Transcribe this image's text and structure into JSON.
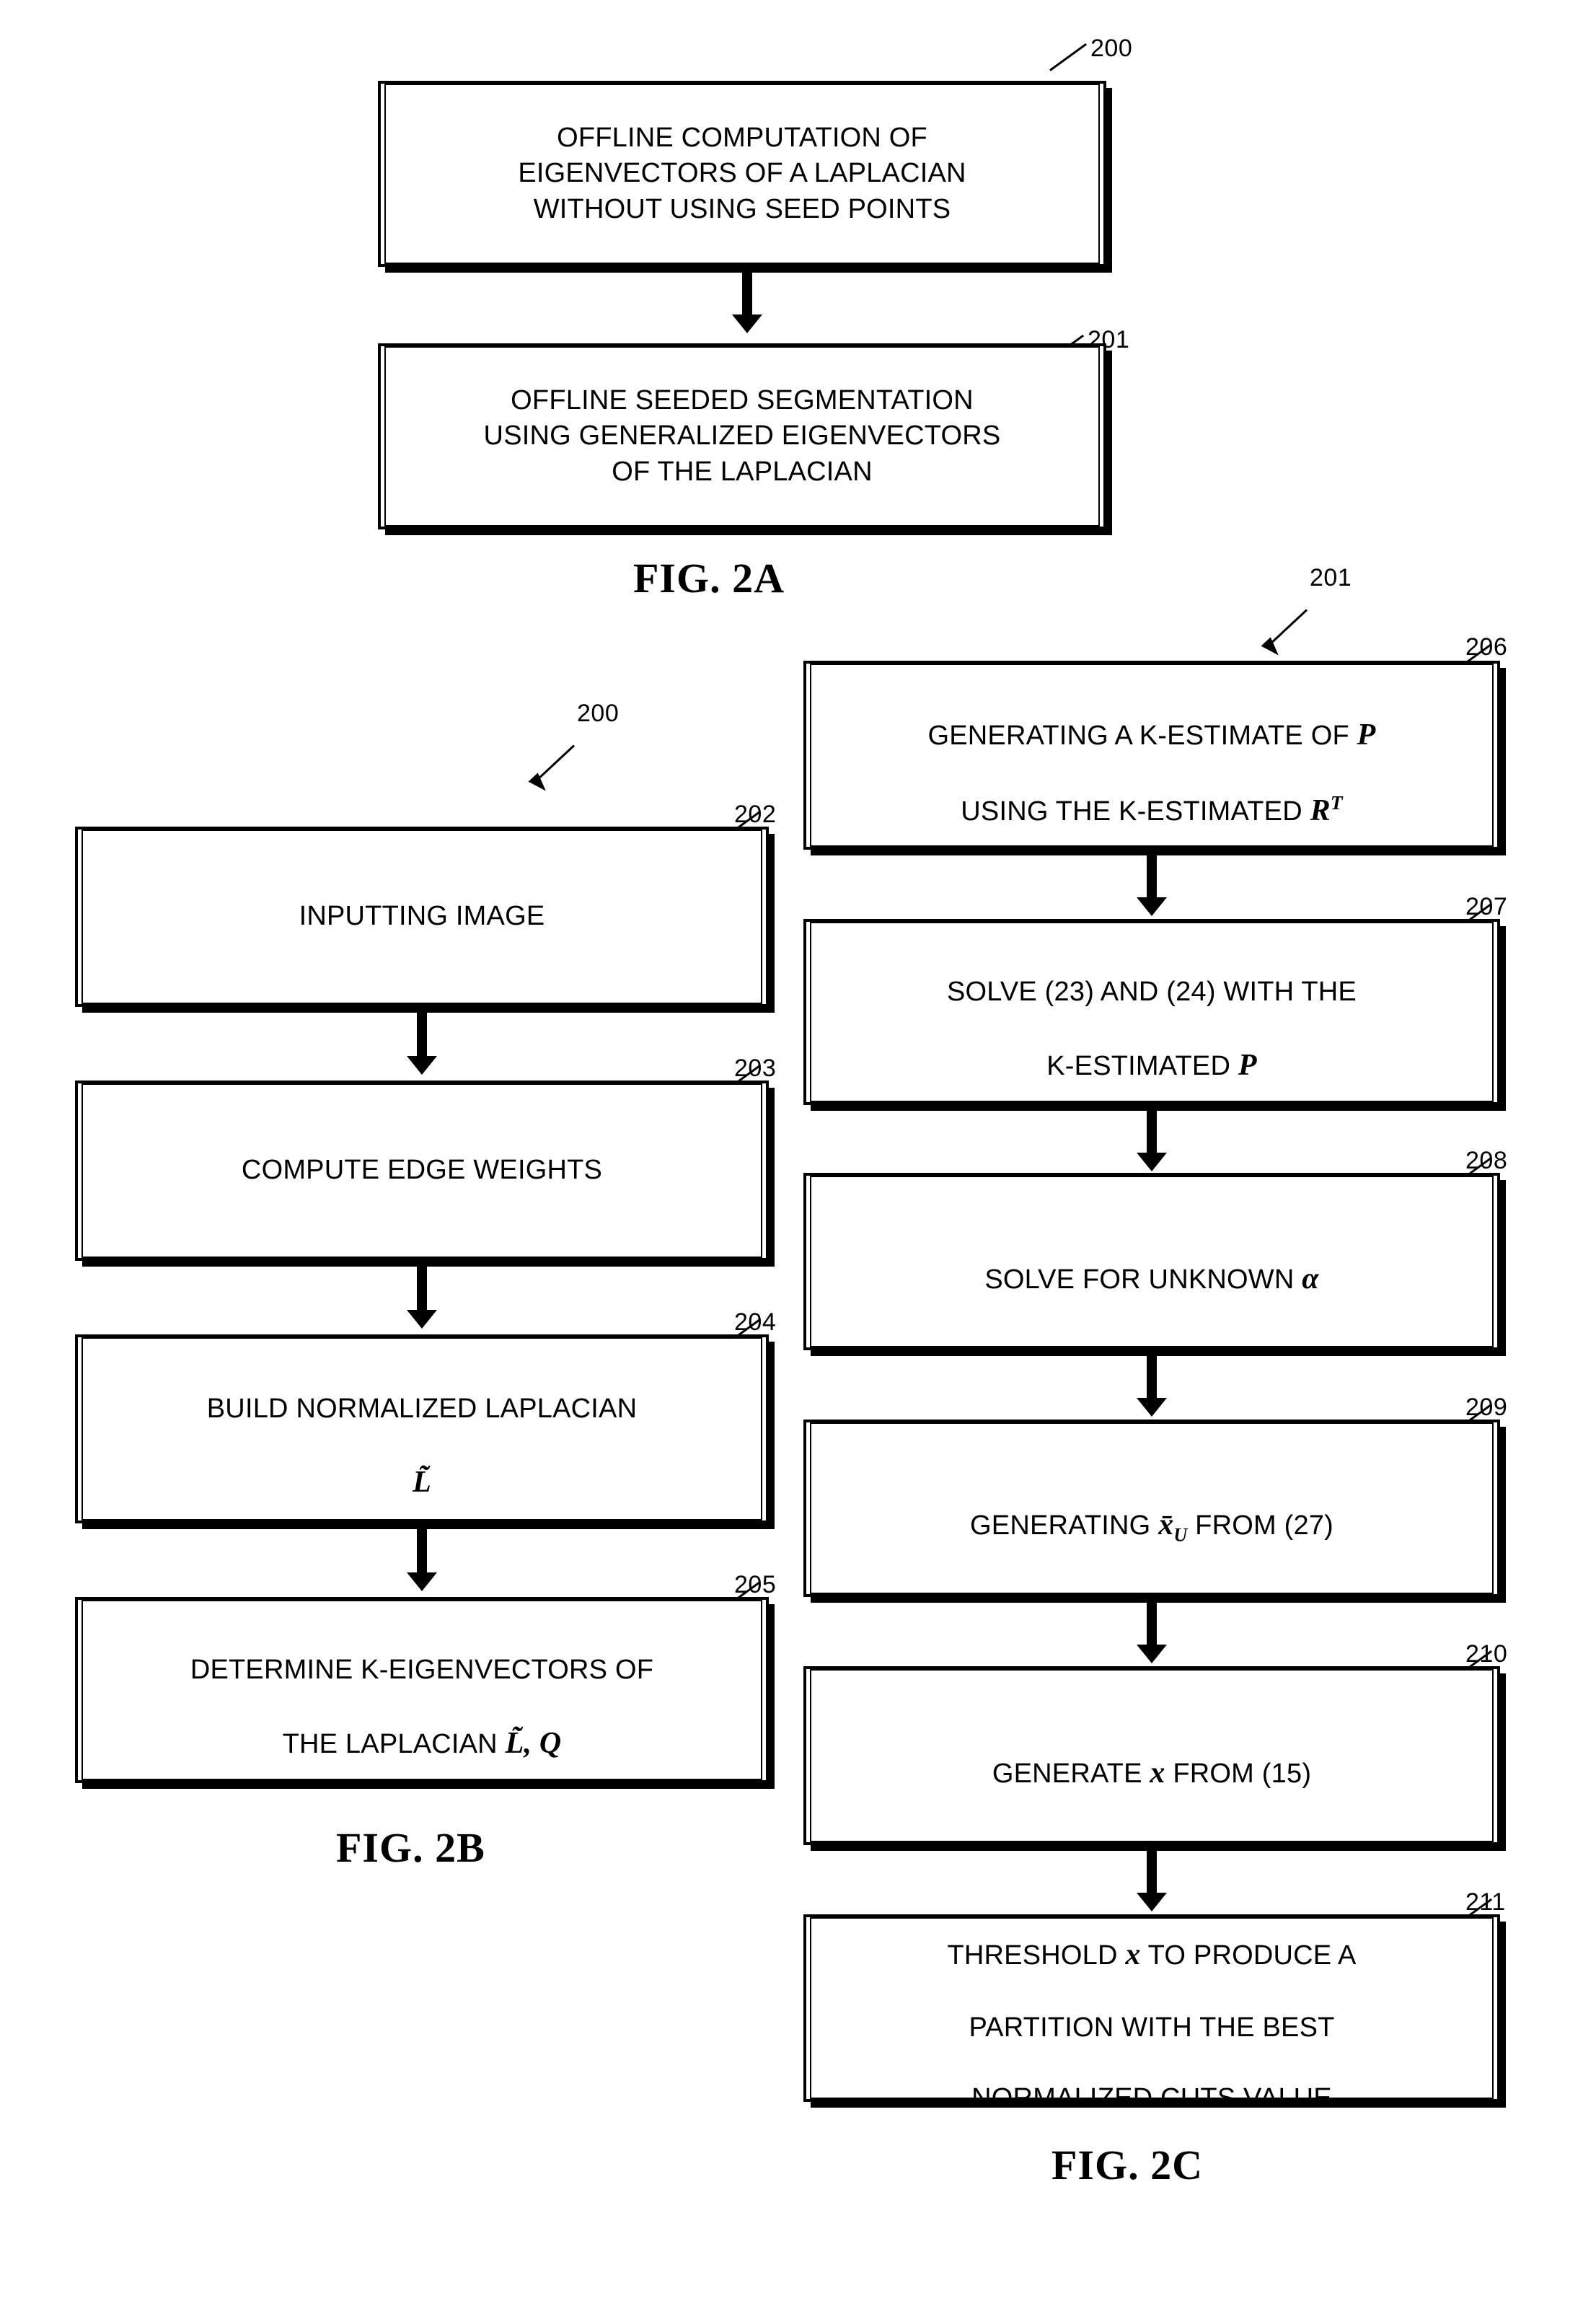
{
  "figure": {
    "title": "Flowchart figures 2A, 2B, 2C",
    "captions": {
      "fig2a": "FIG. 2A",
      "fig2b": "FIG. 2B",
      "fig2c": "FIG. 2C"
    }
  },
  "fig2a": {
    "ref_top": "200",
    "ref_bottom": "201",
    "boxes": [
      {
        "ref": "200",
        "text": "OFFLINE COMPUTATION OF\nEIGENVECTORS OF A LAPLACIAN\nWITHOUT USING SEED POINTS"
      },
      {
        "ref": "201",
        "text": "OFFLINE SEEDED SEGMENTATION\nUSING GENERALIZED EIGENVECTORS\nOF THE LAPLACIAN"
      }
    ]
  },
  "fig2b": {
    "pointer_ref": "200",
    "boxes": [
      {
        "ref": "202",
        "text": "INPUTTING IMAGE"
      },
      {
        "ref": "203",
        "text": "COMPUTE EDGE WEIGHTS"
      },
      {
        "ref": "204",
        "line1": "BUILD NORMALIZED LAPLACIAN",
        "math": "L̃"
      },
      {
        "ref": "205",
        "line1": "DETERMINE K-EIGENVECTORS OF",
        "line2_prefix": "THE LAPLACIAN ",
        "math": "L̃, Q"
      }
    ]
  },
  "fig2c": {
    "pointer_ref": "201",
    "boxes": [
      {
        "ref": "206",
        "line1_prefix": "GENERATING A K-ESTIMATE OF ",
        "line1_math": "P",
        "line2_prefix": "USING THE K-ESTIMATED ",
        "line2_math": "R",
        "line2_math_sup": "T"
      },
      {
        "ref": "207",
        "line1": "SOLVE (23) AND (24) WITH THE",
        "line2_prefix": "K-ESTIMATED ",
        "line2_math": "P"
      },
      {
        "ref": "208",
        "line1_prefix": "SOLVE FOR UNKNOWN ",
        "line1_math": "α"
      },
      {
        "ref": "209",
        "prefix": "GENERATING ",
        "math": "x̄",
        "math_sub": "U",
        "suffix": " FROM (27)"
      },
      {
        "ref": "210",
        "prefix": "GENERATE ",
        "math": "x",
        "suffix": " FROM (15)"
      },
      {
        "ref": "211",
        "line1_prefix": "THRESHOLD ",
        "line1_math": "x",
        "line1_suffix": " TO PRODUCE A",
        "line2": "PARTITION WITH THE BEST",
        "line3": "NORMALIZED CUTS VALUE"
      }
    ]
  }
}
